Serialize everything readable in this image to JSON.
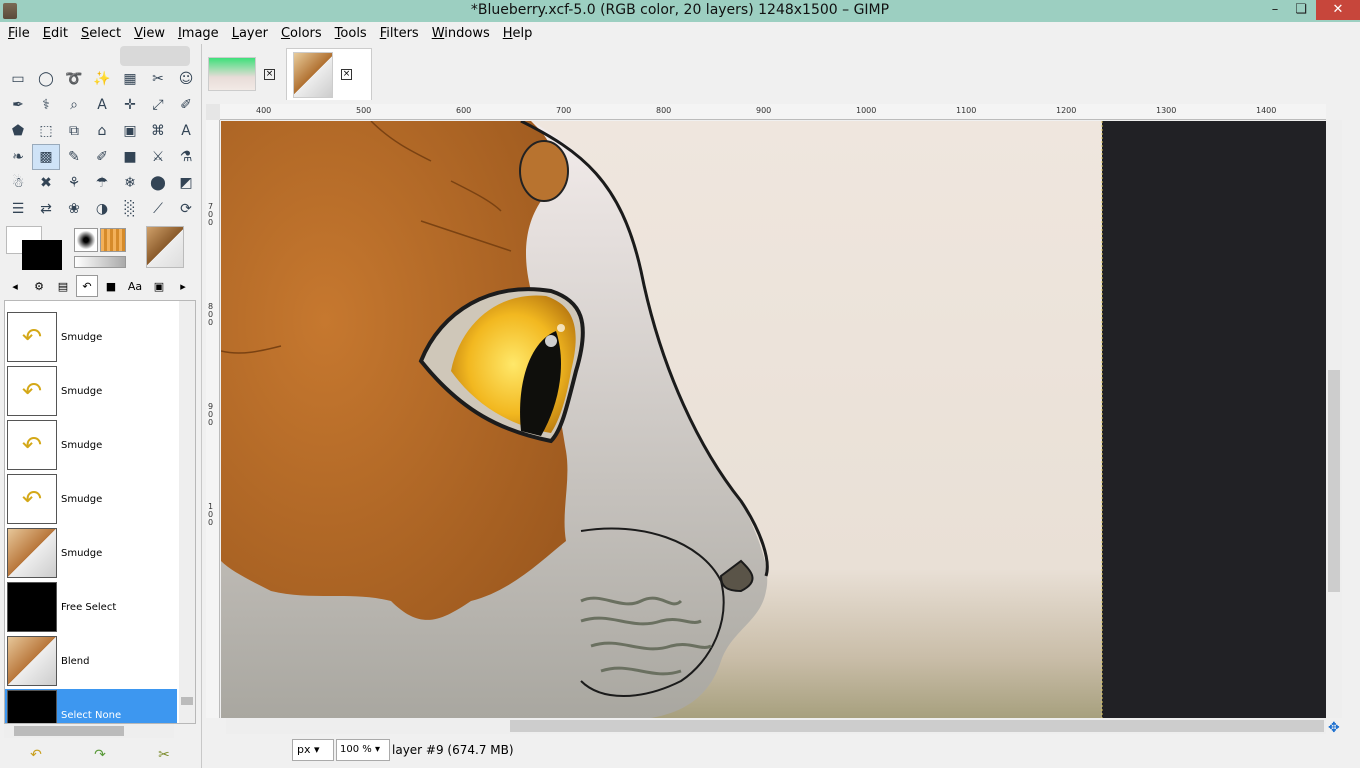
{
  "window": {
    "title": "*Blueberry.xcf-5.0 (RGB color, 20 layers) 1248x1500 – GIMP",
    "min": "–",
    "max": "❏",
    "close": "✕"
  },
  "menu": [
    "File",
    "Edit",
    "Select",
    "View",
    "Image",
    "Layer",
    "Colors",
    "Tools",
    "Filters",
    "Windows",
    "Help"
  ],
  "tools": [
    [
      "▭",
      "◯",
      "➰",
      "✨",
      "▦",
      "✂",
      "☺"
    ],
    [
      "✒",
      "⚕",
      "⌕",
      "A",
      "✛",
      "⤢",
      "✐"
    ],
    [
      "⬟",
      "⬚",
      "⧉",
      "⌂",
      "▣",
      "⌘",
      "A"
    ],
    [
      "❧",
      "▩",
      "✎",
      "✐",
      "■",
      "⚔",
      "⚗"
    ],
    [
      "☃",
      "✖",
      "⚘",
      "☂",
      "❄",
      "⬤",
      "◩"
    ],
    [
      "☰",
      "⇄",
      "❀",
      "◑",
      "░",
      "⟋",
      "⟳"
    ]
  ],
  "history": {
    "items": [
      {
        "label": "Smudge",
        "thumb": "smudge"
      },
      {
        "label": "Smudge",
        "thumb": "smudge"
      },
      {
        "label": "Smudge",
        "thumb": "smudge"
      },
      {
        "label": "Smudge",
        "thumb": "smudge"
      },
      {
        "label": "Smudge",
        "thumb": "cat"
      },
      {
        "label": "Free Select",
        "thumb": "black"
      },
      {
        "label": "Blend",
        "thumb": "cat"
      },
      {
        "label": "Select None",
        "thumb": "black"
      }
    ],
    "undo": "↶",
    "redo": "↷",
    "clear": "✂"
  },
  "rulers": {
    "top": [
      "400",
      "500",
      "600",
      "700",
      "800",
      "900",
      "1000",
      "1100",
      "1200",
      "1300",
      "1400"
    ],
    "left": [
      "7",
      "0",
      "0",
      "8",
      "0",
      "0",
      "9",
      "0",
      "0",
      "1",
      "0",
      "0"
    ]
  },
  "status": {
    "unit": "px",
    "zoom": "100 %",
    "layer": "layer #9 (674.7 MB)"
  },
  "colors": {
    "accent": "#3d97f0",
    "titlebar": "#9ccfc1",
    "close": "#c7463b"
  }
}
